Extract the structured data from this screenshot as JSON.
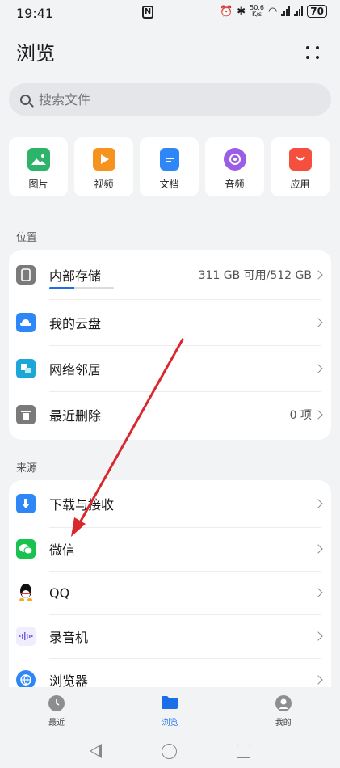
{
  "status": {
    "time": "19:41",
    "nfc": "N",
    "net_speed_value": "50.6",
    "net_speed_unit": "K/s",
    "battery": "70"
  },
  "header": {
    "title": "浏览"
  },
  "search": {
    "placeholder": "搜索文件"
  },
  "categories": [
    {
      "label": "图片",
      "icon": "image-icon",
      "color": "#2db36a"
    },
    {
      "label": "视频",
      "icon": "video-icon",
      "color": "#f6931e"
    },
    {
      "label": "文档",
      "icon": "document-icon",
      "color": "#2f86f6"
    },
    {
      "label": "音频",
      "icon": "audio-icon",
      "color": "#9b5de5"
    },
    {
      "label": "应用",
      "icon": "app-store-icon",
      "color": "#f4503d"
    }
  ],
  "locations": {
    "label": "位置",
    "items": [
      {
        "label": "内部存储",
        "value": "311 GB 可用/512 GB",
        "icon": "phone-icon",
        "color": "#7a7a7a",
        "used_fraction": 0.39
      },
      {
        "label": "我的云盘",
        "value": "",
        "icon": "cloud-icon",
        "color": "#2f86f6"
      },
      {
        "label": "网络邻居",
        "value": "",
        "icon": "network-icon",
        "color": "#1aa7d8"
      },
      {
        "label": "最近删除",
        "value": "0 项",
        "icon": "trash-icon",
        "color": "#7a7a7a"
      }
    ]
  },
  "sources": {
    "label": "来源",
    "items": [
      {
        "label": "下载与接收",
        "icon": "download-icon",
        "color": "#2f86f6"
      },
      {
        "label": "微信",
        "icon": "wechat-icon",
        "color": "#17c24e"
      },
      {
        "label": "QQ",
        "icon": "qq-icon",
        "color": "#111111"
      },
      {
        "label": "录音机",
        "icon": "recorder-icon",
        "color": "#7a5de5"
      },
      {
        "label": "浏览器",
        "icon": "browser-icon",
        "color": "#2f86f6"
      }
    ]
  },
  "bottom_nav": {
    "items": [
      {
        "label": "最近",
        "icon": "clock-icon"
      },
      {
        "label": "浏览",
        "icon": "folder-icon",
        "active": true
      },
      {
        "label": "我的",
        "icon": "profile-icon"
      }
    ]
  },
  "colors": {
    "accent": "#1a6ee8",
    "annotation_arrow": "#d9272e"
  }
}
